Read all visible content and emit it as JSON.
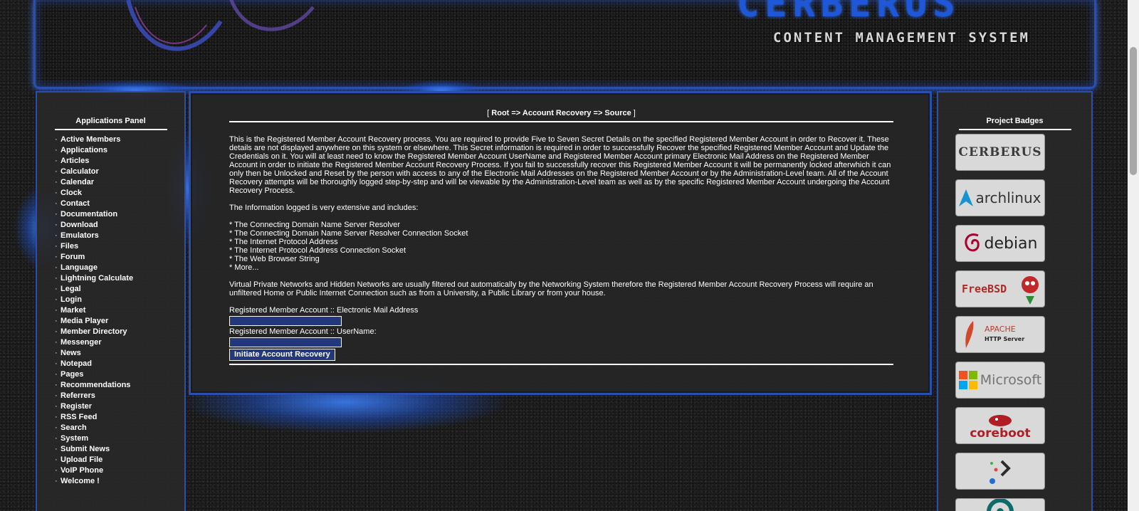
{
  "banner": {
    "title": "CERBERUS",
    "subtitle": "CONTENT MANAGEMENT SYSTEM"
  },
  "left_panel": {
    "title": "Applications Panel",
    "items": [
      "Active Members",
      "Applications",
      "Articles",
      "Calculator",
      "Calendar",
      "Clock",
      "Contact",
      "Documentation",
      "Download",
      "Emulators",
      "Files",
      "Forum",
      "Language",
      "Lightning Calculate",
      "Legal",
      "Login",
      "Market",
      "Media Player",
      "Member Directory",
      "Messenger",
      "News",
      "Notepad",
      "Pages",
      "Recommendations",
      "Referrers",
      "Register",
      "RSS Feed",
      "Search",
      "System",
      "Submit News",
      "Upload File",
      "VoIP Phone",
      "Welcome !"
    ],
    "bullet": "·"
  },
  "right_panel": {
    "title": "Project Badges",
    "badges": [
      {
        "name": "cerberus",
        "label": "CERBERUS",
        "color": "#4a4a4a"
      },
      {
        "name": "archlinux",
        "label": "archlinux",
        "color": "#1793d1"
      },
      {
        "name": "debian",
        "label": "debian",
        "color": "#a80030"
      },
      {
        "name": "freebsd",
        "label": "FreeBSD",
        "color": "#ab2b28"
      },
      {
        "name": "apache",
        "label": "APACHE",
        "sublabel": "HTTP Server",
        "color": "#c0392b"
      },
      {
        "name": "microsoft",
        "label": "Microsoft",
        "color": "#737373"
      },
      {
        "name": "coreboot",
        "label": "coreboot",
        "color": "#b01e23"
      },
      {
        "name": "dots",
        "label": "",
        "color": "#2b2b2b"
      },
      {
        "name": "partial",
        "label": "",
        "color": "#0e6b6b"
      }
    ]
  },
  "main": {
    "breadcrumb_open": "[ ",
    "breadcrumb": "Root => Account Recovery => Source",
    "breadcrumb_close": " ]",
    "paragraph1": "This is the Registered Member Account Recovery process. You are required to provide Five to Seven Secret Details on the specified Registered Member Account in order to Recover it. These details are not displayed anywhere on this system or elsewhere. This Secret information is required in order to successfully Recover the specified Registered Member Account and Update the Credentials on it. You will at least need to know the Registered Member Account UserName and Registered Member Account primary Electronic Mail Address on the Registered Member Account in order to initiate the Registered Member Account Recovery Process. If you fail to successfully recover this Registered Member Account it will be permanently locked afterwhich it can only then be Unlocked and Reset by the person with access to any of the Electronic Mail Addresses on the Registered Member Account or by the Administration-Level team. All of the Account Recovery attempts will be thoroughly logged step-by-step and will be viewable by the Administration-Level team as well as by the specific Registered Member Account undergoing the Account Recovery Process.",
    "paragraph2": "The Information logged is very extensive and includes:",
    "list": [
      "* The Connecting Domain Name Server Resolver",
      "* The Connecting Domain Name Server Resolver Connection Socket",
      "* The Internet Protocol Address",
      "* The Internet Protocol Address Connection Socket",
      "* The Web Browser String",
      "* More..."
    ],
    "paragraph3": "Virtual Private Networks and Hidden Networks are usually filtered out automatically by the Networking System therefore the Registered Member Account Recovery Process will require an unfiltered Home or Public Internet Connection such as from a University, a Public Library or from your house.",
    "email_label": "Registered Member Account :: Electronic Mail Address",
    "email_value": "",
    "username_label": "Registered Member Account :: UserName:",
    "username_value": "",
    "submit_label": "Initiate Account Recovery"
  },
  "colors": {
    "accent_border": "#2a4fb0",
    "input_bg": "#22377c",
    "banner_title": "#1e58d8"
  }
}
